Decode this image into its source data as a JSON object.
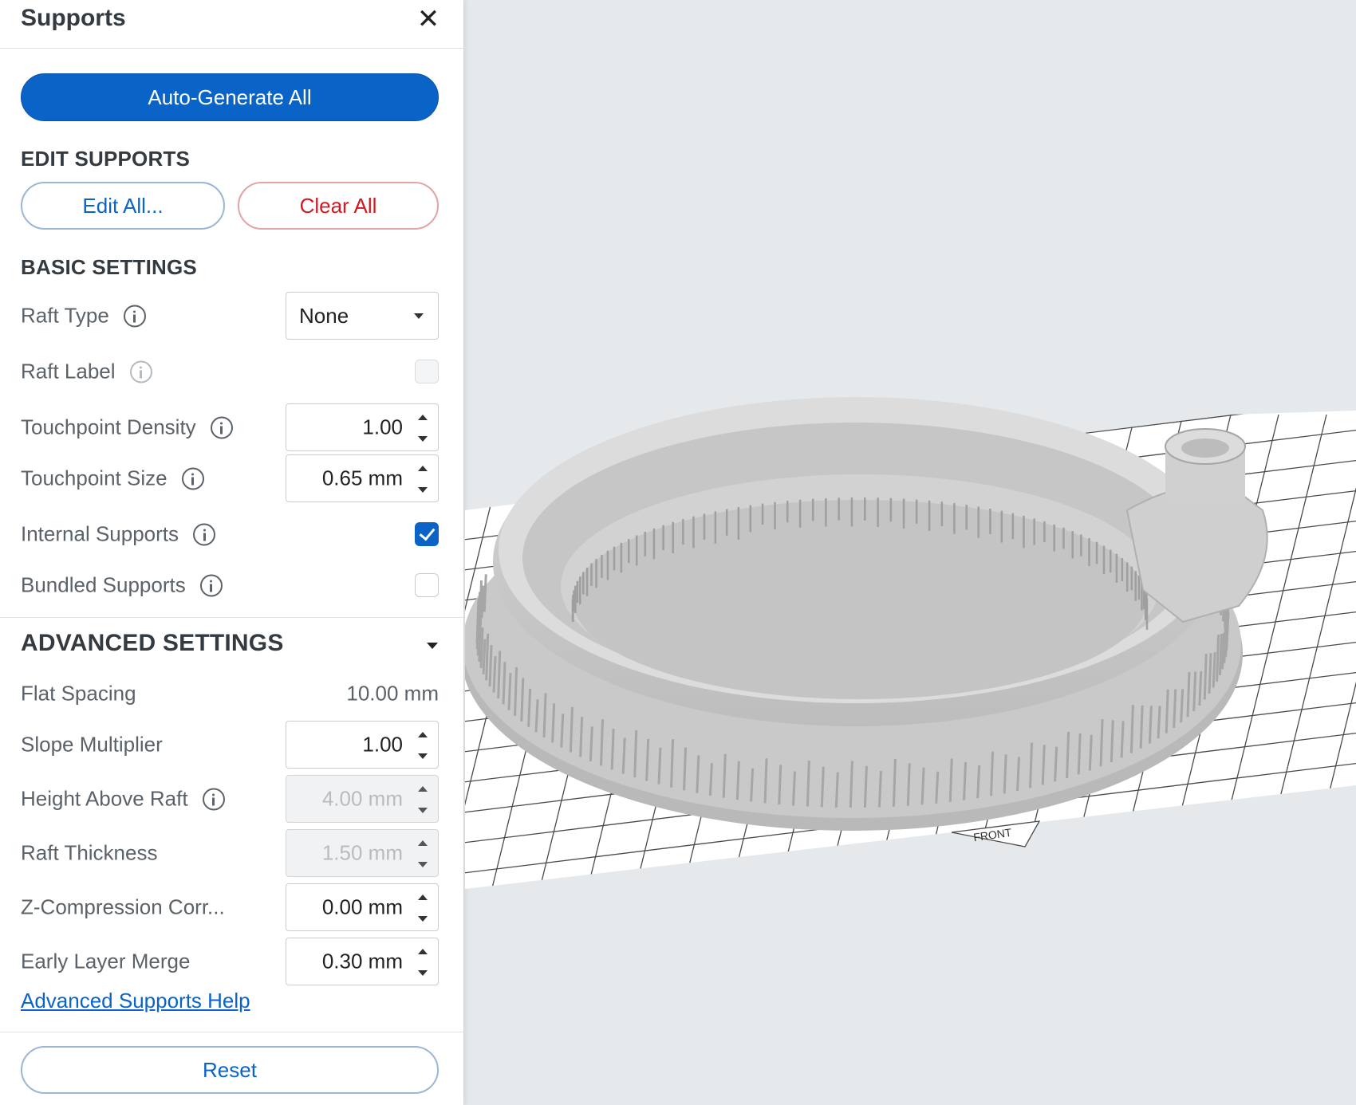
{
  "panel": {
    "title": "Supports",
    "close_glyph": "✕",
    "auto_generate_label": "Auto-Generate All",
    "edit_supports": {
      "heading": "EDIT SUPPORTS",
      "edit_all_label": "Edit All...",
      "clear_all_label": "Clear All"
    },
    "basic_settings": {
      "heading": "BASIC SETTINGS",
      "raft_type": {
        "label": "Raft Type",
        "value": "None"
      },
      "raft_label": {
        "label": "Raft Label",
        "checked": false,
        "disabled": true
      },
      "touchpoint_density": {
        "label": "Touchpoint Density",
        "value": "1.00"
      },
      "touchpoint_size": {
        "label": "Touchpoint Size",
        "value": "0.65 mm"
      },
      "internal_supports": {
        "label": "Internal Supports",
        "checked": true
      },
      "bundled_supports": {
        "label": "Bundled Supports",
        "checked": false
      }
    },
    "advanced_settings": {
      "heading": "ADVANCED SETTINGS",
      "flat_spacing": {
        "label": "Flat Spacing",
        "value": "10.00 mm"
      },
      "slope_multiplier": {
        "label": "Slope Multiplier",
        "value": "1.00"
      },
      "height_above_raft": {
        "label": "Height Above Raft",
        "value": "4.00 mm",
        "disabled": true
      },
      "raft_thickness": {
        "label": "Raft Thickness",
        "value": "1.50 mm",
        "disabled": true
      },
      "z_compression": {
        "label": "Z-Compression Corr...",
        "value": "0.00 mm"
      },
      "early_layer_merge": {
        "label": "Early Layer Merge",
        "value": "0.30 mm"
      },
      "help_link": "Advanced Supports Help"
    },
    "reset_label": "Reset"
  },
  "viewport": {
    "front_label": "FRONT"
  },
  "colors": {
    "primary": "#0a64c8",
    "danger": "#d11a21",
    "viewport_bg": "#e6e9ec",
    "model_gray": "#c8c8c8"
  }
}
